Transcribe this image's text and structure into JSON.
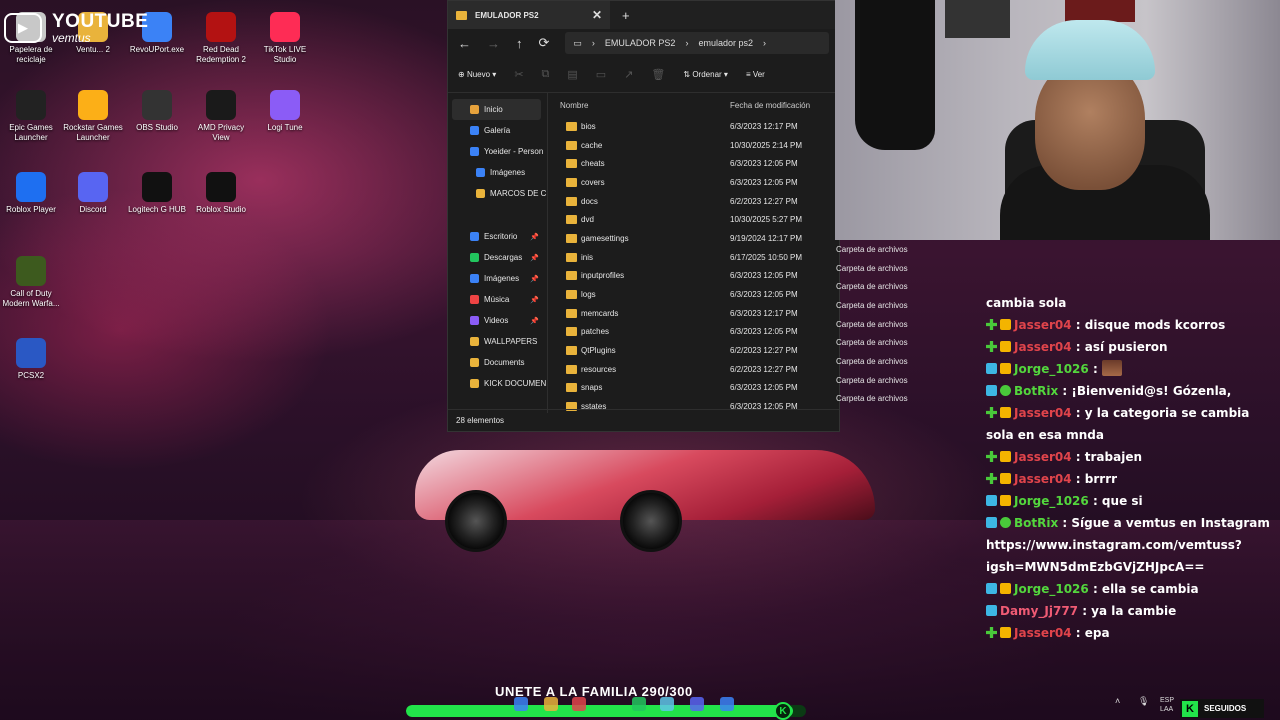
{
  "overlay": {
    "youtube_title": "YOUTUBE",
    "youtube_sub": "vemtus"
  },
  "desktop_icons": [
    {
      "label": "Papelera de reciclaje",
      "icon": "recycle-bin-icon",
      "color": "#c8c8c8"
    },
    {
      "label": "Ventu... 2",
      "icon": "folder-icon",
      "color": "#e9b33b"
    },
    {
      "label": "RevoUPort.exe",
      "icon": "app-icon",
      "color": "#3b82f6"
    },
    {
      "label": "Red Dead Redemption 2",
      "icon": "rdr2-icon",
      "color": "#b31212"
    },
    {
      "label": "TikTok LIVE Studio",
      "icon": "tiktok-icon",
      "color": "#fe2c55"
    },
    {
      "label": "Epic Games Launcher",
      "icon": "epic-icon",
      "color": "#222222"
    },
    {
      "label": "Rockstar Games Launcher",
      "icon": "rockstar-icon",
      "color": "#fcaf17"
    },
    {
      "label": "OBS Studio",
      "icon": "obs-icon",
      "color": "#333333"
    },
    {
      "label": "AMD Privacy View",
      "icon": "amd-icon",
      "color": "#1a1a1a"
    },
    {
      "label": "Logi Tune",
      "icon": "logi-tune-icon",
      "color": "#8b5cf6"
    },
    {
      "label": "Roblox Player",
      "icon": "roblox-icon",
      "color": "#1e6ff1"
    },
    {
      "label": "Discord",
      "icon": "discord-icon",
      "color": "#5865f2"
    },
    {
      "label": "Logitech G HUB",
      "icon": "logitech-icon",
      "color": "#111111"
    },
    {
      "label": "Roblox Studio",
      "icon": "roblox-studio-icon",
      "color": "#111111"
    },
    {
      "label": "Call of Duty Modern Warfa...",
      "icon": "cod-icon",
      "color": "#3d5a1e"
    },
    {
      "label": "PCSX2",
      "icon": "pcsx2-icon",
      "color": "#2a58c4"
    }
  ],
  "explorer": {
    "tab_title": "EMULADOR PS2",
    "path": [
      "EMULADOR PS2",
      "emulador ps2"
    ],
    "toolbar": {
      "new_label": "Nuevo",
      "sort_label": "Ordenar",
      "view_label": "Ver"
    },
    "nav": [
      {
        "label": "Inicio",
        "color": "#e6a23c"
      },
      {
        "label": "Galería",
        "color": "#3b82f6"
      },
      {
        "label": "Yoeider - Person",
        "color": "#3b82f6"
      },
      {
        "label": "Imágenes",
        "color": "#3b82f6"
      },
      {
        "label": "MARCOS DE C",
        "color": "#e9b33b"
      },
      {
        "label": "Escritorio",
        "color": "#3b82f6"
      },
      {
        "label": "Descargas",
        "color": "#22c55e"
      },
      {
        "label": "Imágenes",
        "color": "#3b82f6"
      },
      {
        "label": "Música",
        "color": "#ef4444"
      },
      {
        "label": "Videos",
        "color": "#8b5cf6"
      },
      {
        "label": "WALLPAPERS",
        "color": "#e9b33b"
      },
      {
        "label": "Documents",
        "color": "#e9b33b"
      },
      {
        "label": "KICK DOCUMEN",
        "color": "#e9b33b"
      }
    ],
    "columns": {
      "name": "Nombre",
      "date": "Fecha de modificación"
    },
    "files": [
      {
        "name": "bios",
        "date": "6/3/2023 12:17 PM",
        "type": ""
      },
      {
        "name": "cache",
        "date": "10/30/2025 2:14 PM",
        "type": ""
      },
      {
        "name": "cheats",
        "date": "6/3/2023 12:05 PM",
        "type": ""
      },
      {
        "name": "covers",
        "date": "6/3/2023 12:05 PM",
        "type": ""
      },
      {
        "name": "docs",
        "date": "6/2/2023 12:27 PM",
        "type": ""
      },
      {
        "name": "dvd",
        "date": "10/30/2025 5:27 PM",
        "type": ""
      },
      {
        "name": "gamesettings",
        "date": "9/19/2024 12:17 PM",
        "type": ""
      },
      {
        "name": "inis",
        "date": "6/17/2025 10:50 PM",
        "type": "Carpeta de archivos"
      },
      {
        "name": "inputprofiles",
        "date": "6/3/2023 12:05 PM",
        "type": "Carpeta de archivos"
      },
      {
        "name": "logs",
        "date": "6/3/2023 12:05 PM",
        "type": "Carpeta de archivos"
      },
      {
        "name": "memcards",
        "date": "6/3/2023 12:17 PM",
        "type": "Carpeta de archivos"
      },
      {
        "name": "patches",
        "date": "6/3/2023 12:05 PM",
        "type": "Carpeta de archivos"
      },
      {
        "name": "QtPlugins",
        "date": "6/2/2023 12:27 PM",
        "type": "Carpeta de archivos"
      },
      {
        "name": "resources",
        "date": "6/2/2023 12:27 PM",
        "type": "Carpeta de archivos"
      },
      {
        "name": "snaps",
        "date": "6/3/2023 12:05 PM",
        "type": "Carpeta de archivos"
      },
      {
        "name": "sstates",
        "date": "6/3/2023 12:05 PM",
        "type": "Carpeta de archivos"
      }
    ],
    "status": "28 elementos"
  },
  "chat": {
    "lines": [
      {
        "user": "",
        "text": "cambia sola",
        "badges": [],
        "color": ""
      },
      {
        "user": "Jasser04",
        "text": ": disque mods kcorros",
        "badges": [
          "plus",
          "crown"
        ],
        "color": "red"
      },
      {
        "user": "Jasser04",
        "text": ": así pusieron",
        "badges": [
          "plus",
          "crown"
        ],
        "color": "red"
      },
      {
        "user": "Jorge_1026",
        "text": ":",
        "badges": [
          "sword",
          "crown"
        ],
        "color": "green",
        "emote": true
      },
      {
        "user": "BotRix",
        "text": ": ¡Bienvenid@s! Gózenla,",
        "badges": [
          "sword",
          "check"
        ],
        "color": "green"
      },
      {
        "user": "Jasser04",
        "text": ": y la categoria se cambia sola en esa mnda",
        "badges": [
          "plus",
          "crown"
        ],
        "color": "red"
      },
      {
        "user": "Jasser04",
        "text": ": trabajen",
        "badges": [
          "plus",
          "crown"
        ],
        "color": "red"
      },
      {
        "user": "Jasser04",
        "text": ": brrrr",
        "badges": [
          "plus",
          "crown"
        ],
        "color": "red"
      },
      {
        "user": "Jorge_1026",
        "text": ": que si",
        "badges": [
          "sword",
          "crown"
        ],
        "color": "green"
      },
      {
        "user": "BotRix",
        "text": ": Sígue a vemtus en Instagram https://www.instagram.com/vemtuss?igsh=MWN5dmEzbGVjZHJpcA==",
        "badges": [
          "sword",
          "check"
        ],
        "color": "green"
      },
      {
        "user": "Jorge_1026",
        "text": ": ella se cambia",
        "badges": [
          "sword",
          "crown"
        ],
        "color": "green"
      },
      {
        "user": "Damy_Jj777",
        "text": ": ya la cambie",
        "badges": [
          "sword"
        ],
        "color": "pink"
      },
      {
        "user": "Jasser04",
        "text": ": epa",
        "badges": [
          "plus",
          "crown"
        ],
        "color": "red"
      }
    ]
  },
  "goal": {
    "text": "UNETE A LA FAMILIA 290/300",
    "current": 290,
    "target": 300,
    "accent": "#22e34a"
  },
  "tray": {
    "lang": "ESP LAA",
    "follow_label": "SEGUIDOS"
  }
}
